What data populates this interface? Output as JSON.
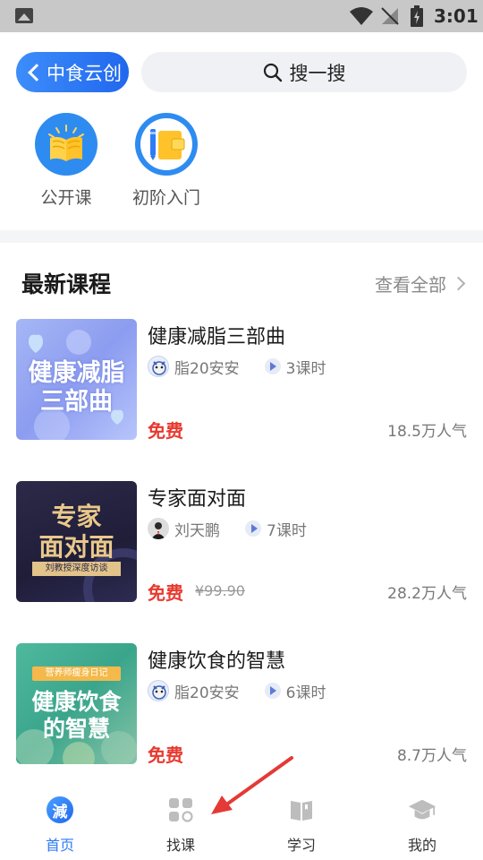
{
  "status_bar": {
    "time": "3:01",
    "icons": [
      "gallery-icon",
      "wifi-icon",
      "no-sim-icon",
      "battery-icon"
    ]
  },
  "header": {
    "back_label": "中食云创",
    "search_label": "搜一搜"
  },
  "categories": [
    {
      "label": "公开课",
      "icon": "open-book-icon",
      "color": "#2e8cf0"
    },
    {
      "label": "初阶入门",
      "icon": "notebook-pencil-icon",
      "color": "#2e8cf0"
    }
  ],
  "section": {
    "title": "最新课程",
    "view_all": "查看全部"
  },
  "courses": [
    {
      "title": "健康减脂三部曲",
      "author": "脂20安安",
      "lessons": "3课时",
      "price": "免费",
      "original_price": "",
      "popularity": "18.5万人气",
      "thumb_lines": [
        "健康减脂",
        "三部曲"
      ]
    },
    {
      "title": "专家面对面",
      "author": "刘天鹏",
      "lessons": "7课时",
      "price": "免费",
      "original_price": "¥99.90",
      "popularity": "28.2万人气",
      "thumb_lines": [
        "专家",
        "面对面"
      ],
      "thumb_sub": "刘教授深度访谈"
    },
    {
      "title": "健康饮食的智慧",
      "author": "脂20安安",
      "lessons": "6课时",
      "price": "免费",
      "original_price": "",
      "popularity": "8.7万人气",
      "thumb_lines": [
        "健康饮食",
        "的智慧"
      ],
      "thumb_sub": "营养师瘦身日记"
    }
  ],
  "tabbar": [
    {
      "label": "首页",
      "icon": "home-logo-icon",
      "icon_text": "減",
      "active": true
    },
    {
      "label": "找课",
      "icon": "grid-icon",
      "active": false
    },
    {
      "label": "学习",
      "icon": "book-icon",
      "active": false
    },
    {
      "label": "我的",
      "icon": "graduation-cap-icon",
      "active": false
    }
  ],
  "colors": {
    "accent": "#2e7cf6",
    "price": "#e8392f"
  }
}
